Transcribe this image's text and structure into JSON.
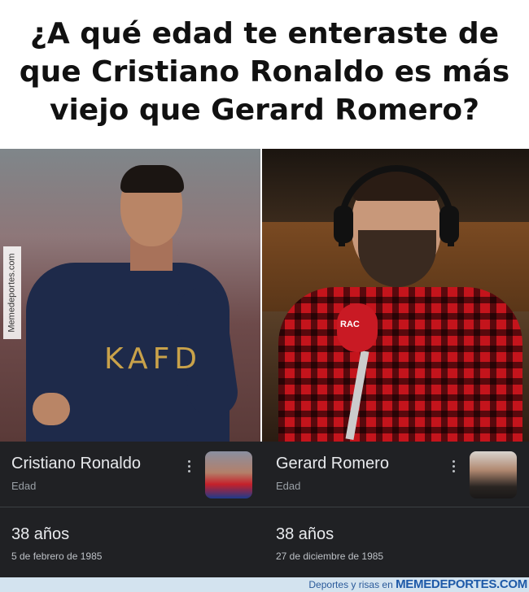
{
  "headline": {
    "lines": [
      "¿A qué edad te enteraste de",
      "que Cristiano Ronaldo es más",
      "viejo que Gerard Romero?"
    ]
  },
  "photos": {
    "left": {
      "shirt_text": "KAFD",
      "side_watermark": "Memedeportes.com"
    },
    "right": {
      "mic_text": "RAC"
    }
  },
  "cards": [
    {
      "name": "Cristiano Ronaldo",
      "label": "Edad",
      "age": "38 años",
      "birth": "5 de febrero de 1985"
    },
    {
      "name": "Gerard Romero",
      "label": "Edad",
      "age": "38 años",
      "birth": "27 de diciembre de 1985"
    }
  ],
  "footer": {
    "tagline": "Deportes y risas en",
    "brand": "MEMEDEPORTES.COM"
  },
  "colors": {
    "card_bg": "#202124",
    "footer_bg": "#d3e3ef",
    "brand_blue": "#1e5aa8"
  },
  "icons": [
    "more-vert-icon"
  ]
}
